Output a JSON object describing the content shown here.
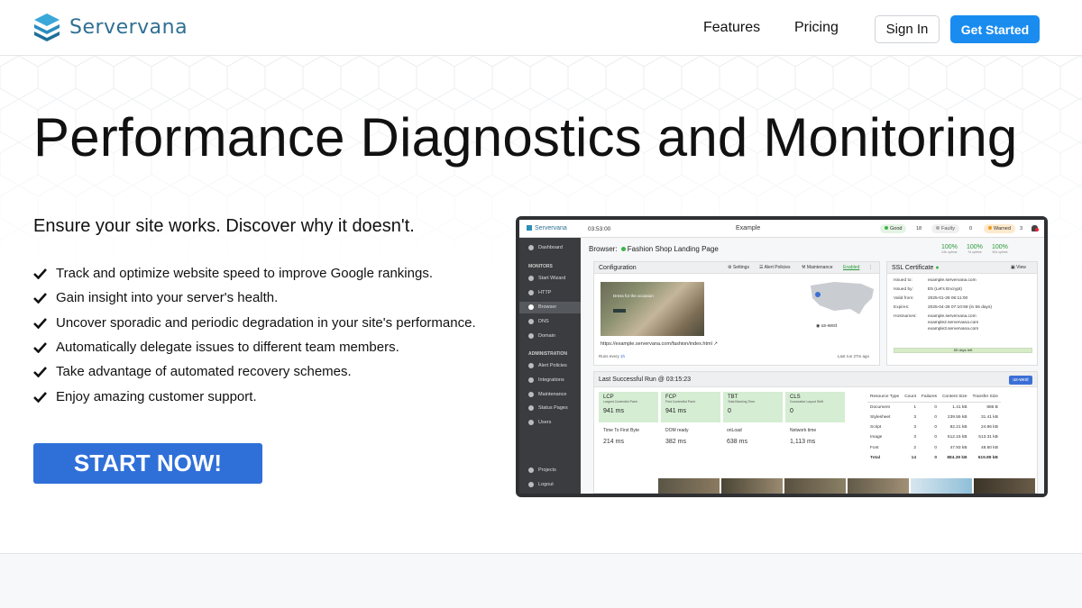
{
  "brand": {
    "name": "Servervana",
    "icon": "stacked-layers-logo-icon",
    "color": "#2f6f93"
  },
  "nav": {
    "features": "Features",
    "pricing": "Pricing",
    "sign_in": "Sign In",
    "get_started": "Get Started"
  },
  "colors": {
    "accent": "#1a8cf0",
    "cta": "#2f6fd8",
    "good": "#3bb54a"
  },
  "hero": {
    "title": "Performance Diagnostics and Monitoring",
    "subtitle": "Ensure your site works. Discover why it doesn't.",
    "features": [
      "Track and optimize website speed to improve Google rankings.",
      "Gain insight into your server's health.",
      "Uncover sporadic and periodic degradation in your site's performance.",
      "Automatically delegate issues to different team members.",
      "Take advantage of automated recovery schemes.",
      "Enjoy amazing customer support."
    ],
    "cta": "START NOW!"
  },
  "app": {
    "logo": "Servervana",
    "time": "03:53:00",
    "title": "Example",
    "status": {
      "good_label": "Good",
      "good_count": "18",
      "faulty_label": "Faulty",
      "faulty_count": "0",
      "warned_label": "Warned",
      "warned_count": "3"
    },
    "sidebar": {
      "dashboard": "Dashboard",
      "monitors_head": "MONITORS",
      "start_wizard": "Start Wizard",
      "http": "HTTP",
      "browser": "Browser",
      "dns": "DNS",
      "domain": "Domain",
      "admin_head": "ADMINISTRATION",
      "alert_policies": "Alert Policies",
      "integrations": "Integrations",
      "maintenance": "Maintenance",
      "status_pages": "Status Pages",
      "users": "Users",
      "projects": "Projects",
      "logout": "Logout"
    },
    "breadcrumb_prefix": "Browser:",
    "breadcrumb_page": "Fashion Shop Landing Page",
    "uptime": [
      {
        "pct": "100%",
        "label": "24h uptime"
      },
      {
        "pct": "100%",
        "label": "7d uptime"
      },
      {
        "pct": "100%",
        "label": "30d uptime"
      }
    ],
    "config": {
      "title": "Configuration",
      "settings": "Settings",
      "alert_policies": "Alert Policies",
      "maintenance": "Maintenance",
      "enabled": "Enabled",
      "thumb_title": "Dress for the occasion",
      "region": "us-west",
      "url": "https://example.servervana.com/fashion/index.html",
      "runs_prefix": "Runs every",
      "runs_value": "1h",
      "last_run": "Last run 27m ago"
    },
    "ssl": {
      "title": "SSL Certificate",
      "view": "View",
      "issued_to_k": "Issued to:",
      "issued_to_v": "example.servervana.com",
      "issued_by_k": "Issued by:",
      "issued_by_v": "E5 (Let's Encrypt)",
      "valid_from_k": "Valid from:",
      "valid_from_v": "2025-01-28 06:11:00",
      "expires_k": "Expires:",
      "expires_v": "2025-04-28 07:10:59 (in 55 days)",
      "hostnames_k": "Hostnames:",
      "hostnames": [
        "example.servervana.com",
        "example2.servervana.com",
        "example3.servervana.com"
      ],
      "days_left": "55 days left",
      "validity_fraction": 1.0
    },
    "last_run": {
      "title": "Last Successful Run @ 03:15:23",
      "region": "us-west",
      "metrics": [
        {
          "name": "LCP",
          "desc": "Largest Contentful Paint",
          "value": "941 ms"
        },
        {
          "name": "FCP",
          "desc": "First Contentful Paint",
          "value": "941 ms"
        },
        {
          "name": "TBT",
          "desc": "Total Blocking Time",
          "value": "0"
        },
        {
          "name": "CLS",
          "desc": "Cumulative Layout Shift",
          "value": "0"
        }
      ],
      "timings": [
        {
          "name": "Time To First Byte",
          "value": "214 ms"
        },
        {
          "name": "DOM ready",
          "value": "382 ms"
        },
        {
          "name": "onLoad",
          "value": "638 ms"
        },
        {
          "name": "Network time",
          "value": "1,113 ms"
        }
      ],
      "table_headers": [
        "Resource Type",
        "Count",
        "Failures",
        "Content Size",
        "Transfer Size"
      ],
      "table_rows": [
        [
          "Document",
          "1",
          "0",
          "1.41 kB",
          "886 B"
        ],
        [
          "Stylesheet",
          "3",
          "0",
          "239.55 kB",
          "31.41 kB"
        ],
        [
          "Script",
          "3",
          "0",
          "82.21 kB",
          "24.86 kB"
        ],
        [
          "Image",
          "3",
          "0",
          "512.15 kB",
          "513.31 kB"
        ],
        [
          "Font",
          "2",
          "0",
          "47.93 kB",
          "48.60 kB"
        ],
        [
          "Total",
          "14",
          "0",
          "884.39 kB",
          "619.89 kB"
        ]
      ]
    }
  }
}
